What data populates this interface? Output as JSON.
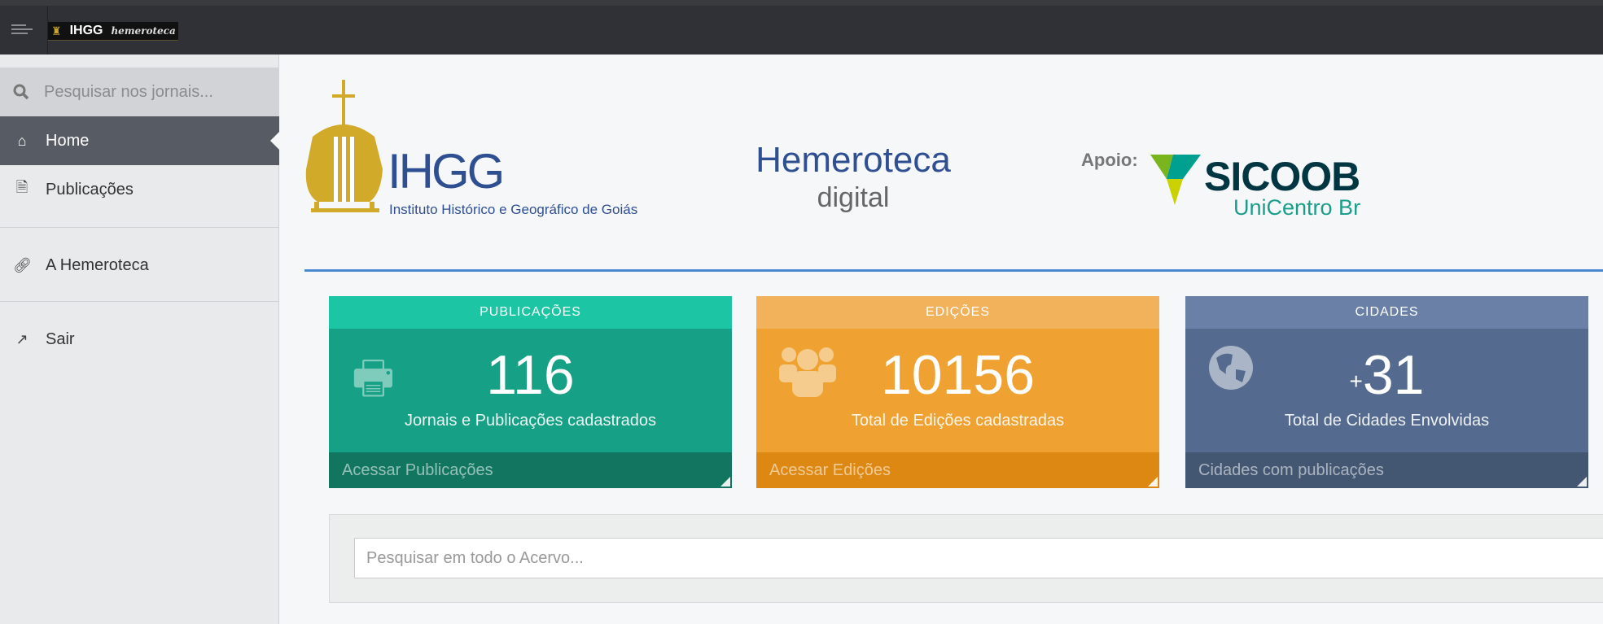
{
  "topbar": {
    "brand_bold": "IHGG",
    "brand_italic": "hemeroteca"
  },
  "sidebar": {
    "search_placeholder": "Pesquisar nos jornais...",
    "items": [
      {
        "label": "Home",
        "icon": "home-icon",
        "active": true
      },
      {
        "label": "Publicações",
        "icon": "pdf-file-icon"
      },
      {
        "label": "A Hemeroteca",
        "icon": "link-icon"
      },
      {
        "label": "Sair",
        "icon": "external-link-icon"
      }
    ]
  },
  "header": {
    "ihgg_logo": "IHGG",
    "ihgg_subtitle": "Instituto Histórico e Geográfico de Goiás",
    "hemeroteca_title": "Hemeroteca",
    "hemeroteca_sub": "digital",
    "apoio": "Apoio:",
    "sponsor_name": "SICOOB",
    "sponsor_sub": "UniCentro Br"
  },
  "cards": [
    {
      "title": "PUBLICAÇÕES",
      "prefix": "",
      "value": "116",
      "subtitle": "Jornais e Publicações cadastrados",
      "link": "Acessar Publicações",
      "icon": "print-icon",
      "color": "#16a085"
    },
    {
      "title": "EDIÇÕES",
      "prefix": "",
      "value": "10156",
      "subtitle": "Total de Edições cadastradas",
      "link": "Acessar Edições",
      "icon": "users-icon",
      "color": "#efa231"
    },
    {
      "title": "CIDADES",
      "prefix": "+",
      "value": "31",
      "subtitle": "Total de Cidades Envolvidas",
      "link": "Cidades com publicações",
      "icon": "globe-icon",
      "color": "#546b8f"
    }
  ],
  "search": {
    "placeholder": "Pesquisar em todo o Acervo..."
  }
}
